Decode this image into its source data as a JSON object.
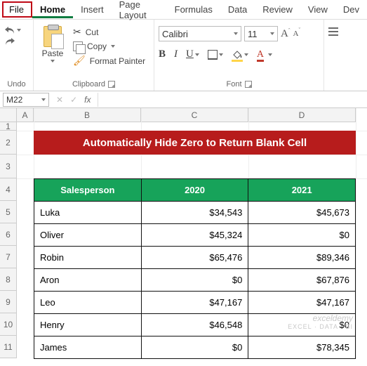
{
  "tabs": {
    "file": "File",
    "home": "Home",
    "insert": "Insert",
    "page_layout": "Page Layout",
    "formulas": "Formulas",
    "data": "Data",
    "review": "Review",
    "view": "View",
    "developer": "Dev"
  },
  "ribbon": {
    "undo_label": "Undo",
    "clipboard": {
      "paste": "Paste",
      "cut": "Cut",
      "copy": "Copy",
      "format_painter": "Format Painter",
      "group_label": "Clipboard"
    },
    "font": {
      "name": "Calibri",
      "size": "11",
      "group_label": "Font"
    }
  },
  "formula_bar": {
    "name_box": "M22",
    "fx": "fx"
  },
  "columns": [
    "A",
    "B",
    "C",
    "D"
  ],
  "rows": [
    "1",
    "2",
    "3",
    "4",
    "5",
    "6",
    "7",
    "8",
    "9",
    "10",
    "11"
  ],
  "title": "Automatically Hide Zero to Return Blank Cell",
  "headers": {
    "salesperson": "Salesperson",
    "y2020": "2020",
    "y2021": "2021"
  },
  "data_rows": [
    {
      "name": "Luka",
      "y2020": "$34,543",
      "y2021": "$45,673"
    },
    {
      "name": "Oliver",
      "y2020": "$45,324",
      "y2021": "$0"
    },
    {
      "name": "Robin",
      "y2020": "$65,476",
      "y2021": "$89,346"
    },
    {
      "name": "Aron",
      "y2020": "$0",
      "y2021": "$67,876"
    },
    {
      "name": "Leo",
      "y2020": "$47,167",
      "y2021": "$47,167"
    },
    {
      "name": "Henry",
      "y2020": "$46,548",
      "y2021": "$0"
    },
    {
      "name": "James",
      "y2020": "$0",
      "y2021": "$78,345"
    }
  ],
  "watermark": {
    "line1": "exceldemy",
    "line2": "EXCEL · DATA · BI"
  },
  "chart_data": {
    "type": "table",
    "title": "Automatically Hide Zero to Return Blank Cell",
    "columns": [
      "Salesperson",
      "2020",
      "2021"
    ],
    "rows": [
      [
        "Luka",
        34543,
        45673
      ],
      [
        "Oliver",
        45324,
        0
      ],
      [
        "Robin",
        65476,
        89346
      ],
      [
        "Aron",
        0,
        67876
      ],
      [
        "Leo",
        47167,
        47167
      ],
      [
        "Henry",
        46548,
        0
      ],
      [
        "James",
        0,
        78345
      ]
    ]
  }
}
